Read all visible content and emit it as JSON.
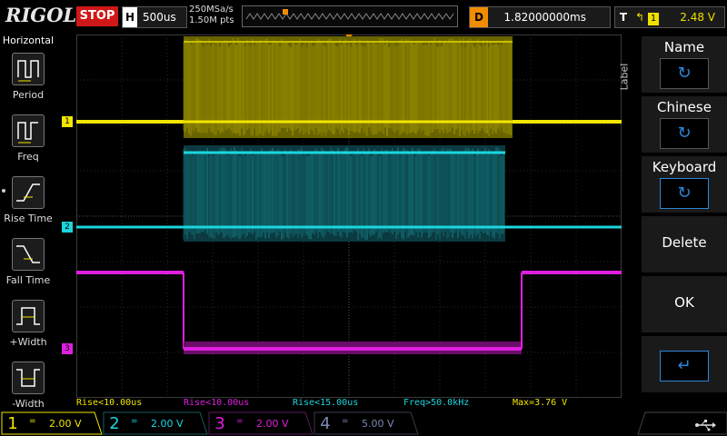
{
  "brand": "RIGOL",
  "run_status": "STOP",
  "horizontal": {
    "tag": "H",
    "timebase": "500us"
  },
  "sample_rate": "250MSa/s",
  "memory_depth": "1.50M pts",
  "delay": {
    "tag": "D",
    "value": "1.82000000ms"
  },
  "trigger": {
    "tag": "T",
    "source": "1",
    "level": "2.48 V"
  },
  "left_menu": {
    "title": "Horizontal",
    "items": [
      {
        "label": "Period",
        "icon": "period-icon"
      },
      {
        "label": "Freq",
        "icon": "freq-icon"
      },
      {
        "label": "Rise Time",
        "icon": "rise-time-icon"
      },
      {
        "label": "Fall Time",
        "icon": "fall-time-icon"
      },
      {
        "label": "+Width",
        "icon": "pos-width-icon"
      },
      {
        "label": "-Width",
        "icon": "neg-width-icon"
      }
    ]
  },
  "right_menu": {
    "section_label": "Label",
    "items": [
      {
        "label": "Name",
        "has_knob": true
      },
      {
        "label": "Chinese",
        "has_knob": true
      },
      {
        "label": "Keyboard",
        "has_knob": true
      },
      {
        "label": "Delete",
        "has_knob": false
      },
      {
        "label": "OK",
        "has_knob": false
      }
    ]
  },
  "channel_markers": [
    {
      "id": "1",
      "color": "#f2e600"
    },
    {
      "id": "2",
      "color": "#1ad6e0"
    },
    {
      "id": "3",
      "color": "#e01ee0"
    }
  ],
  "measurements": [
    {
      "text": "Rise<10.00us",
      "color": "#f2e600"
    },
    {
      "text": "Rise<10.00us",
      "color": "#e01ee0"
    },
    {
      "text": "Rise<15.00us",
      "color": "#1ad6e0"
    },
    {
      "text": "Freq>50.0kHz",
      "color": "#1ad6e0"
    },
    {
      "text": "Max=3.76 V",
      "color": "#f2e600"
    }
  ],
  "channels": [
    {
      "num": "1",
      "coupling": "=",
      "scale": "2.00 V",
      "color": "#f2e600",
      "active": true
    },
    {
      "num": "2",
      "coupling": "=",
      "scale": "2.00 V",
      "color": "#1ad6e0",
      "active": false
    },
    {
      "num": "3",
      "coupling": "=",
      "scale": "2.00 V",
      "color": "#e01ee0",
      "active": false
    },
    {
      "num": "4",
      "coupling": "=",
      "scale": "5.00 V",
      "color": "#7a8ab0",
      "active": false
    }
  ],
  "colors": {
    "ch1": "#f2e600",
    "ch2": "#1ad6e0",
    "ch3": "#e01ee0",
    "ch4": "#7a8ab0",
    "accent": "#2e86d6",
    "stop": "#d01818"
  }
}
